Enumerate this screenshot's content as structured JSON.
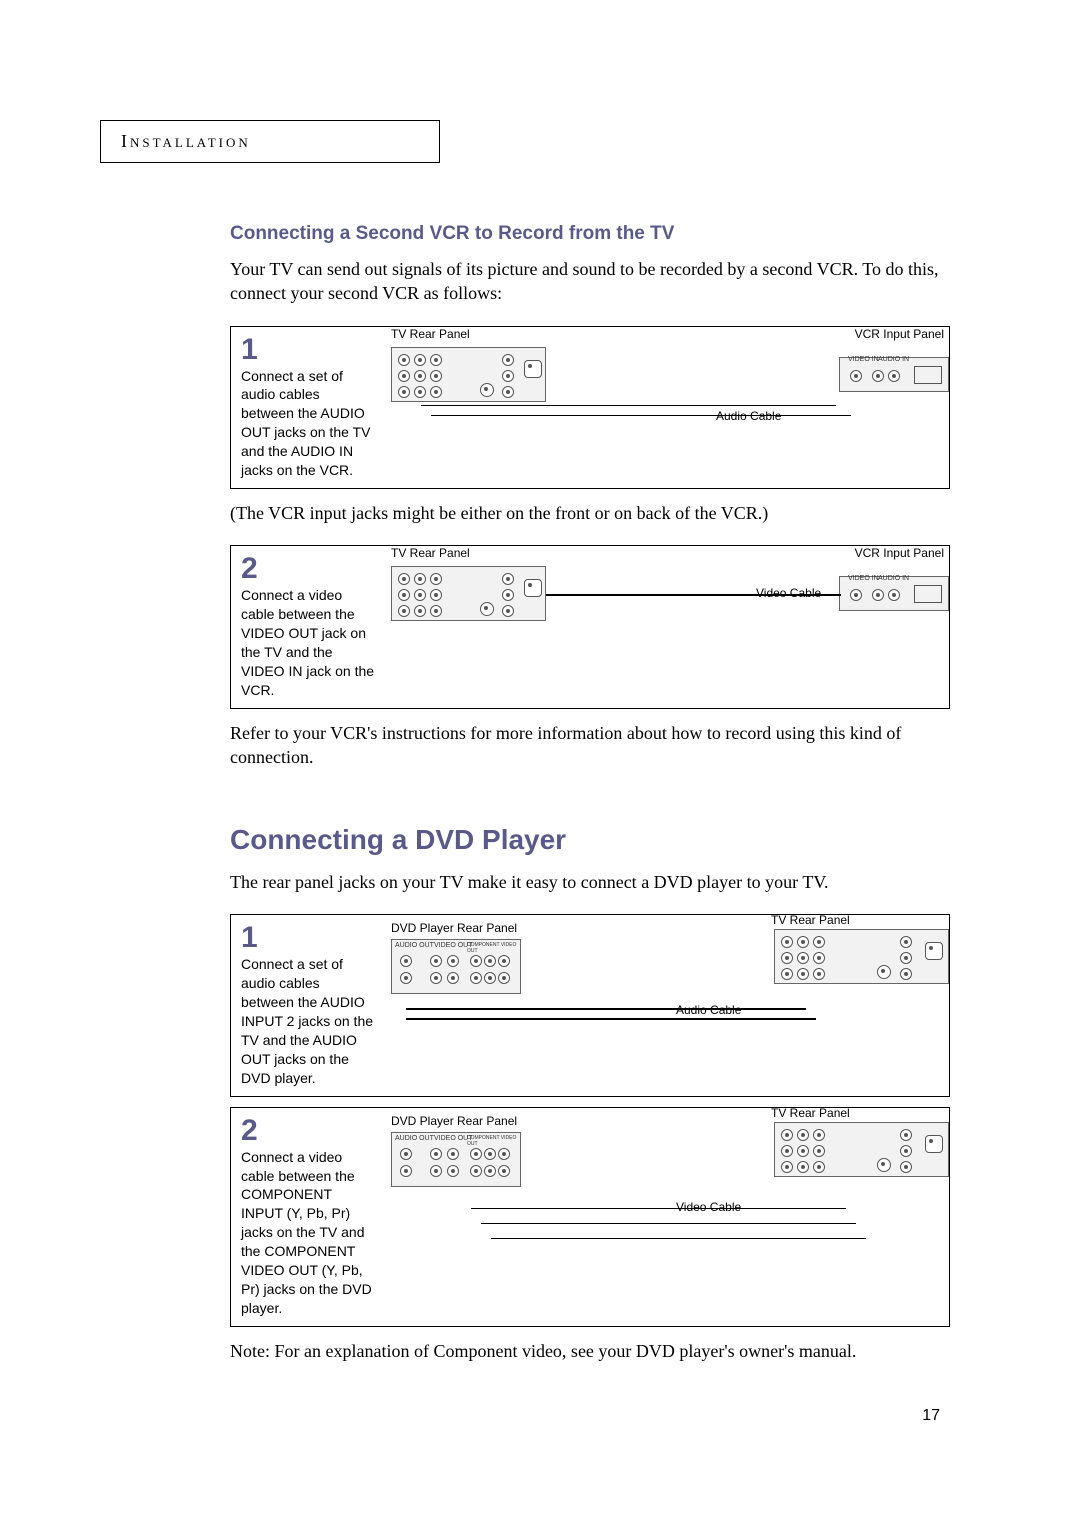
{
  "header": "Installation",
  "subtitle1": "Connecting a Second VCR to Record from the TV",
  "intro1": "Your TV can send out signals of its picture and sound to be recorded by a second VCR. To do this, connect your second VCR as follows:",
  "vcr": {
    "step1": {
      "num": "1",
      "text": "Connect a set of audio cables between the AUDIO OUT jacks on the TV and the AUDIO IN jacks on the VCR.",
      "tv_label": "TV Rear Panel",
      "vcr_label": "VCR Input Panel",
      "cable": "Audio Cable",
      "vcr_jack_video": "VIDEO IN",
      "vcr_jack_audio": "AUDIO IN"
    },
    "note_between": "(The VCR input jacks might be either on the front or on back of the VCR.)",
    "step2": {
      "num": "2",
      "text": "Connect a video cable between the VIDEO OUT jack on the TV and the VIDEO IN jack on the VCR.",
      "tv_label": "TV Rear Panel",
      "vcr_label": "VCR Input Panel",
      "cable": "Video Cable",
      "vcr_jack_video": "VIDEO IN",
      "vcr_jack_audio": "AUDIO IN"
    },
    "after": "Refer to your VCR's instructions for more information about how to record using this kind of connection."
  },
  "section2": "Connecting a DVD Player",
  "intro2": "The rear panel jacks on your TV make it easy to connect a DVD player to your TV.",
  "dvd": {
    "step1": {
      "num": "1",
      "text": "Connect a set of audio cables between the AUDIO INPUT 2 jacks on the TV and the AUDIO OUT jacks on the DVD player.",
      "dvd_label": "DVD Player Rear Panel",
      "tv_label": "TV Rear Panel",
      "cable": "Audio Cable",
      "dvd_jacks": {
        "a": "AUDIO OUT",
        "b": "VIDEO OUT",
        "c": "COMPONENT VIDEO OUT"
      }
    },
    "step2": {
      "num": "2",
      "text": "Connect a video cable between the COMPO­NENT INPUT (Y, Pb, Pr) jacks on the TV and the COMPONENT VIDEO OUT (Y, Pb, Pr) jacks on the DVD player.",
      "dvd_label": "DVD Player Rear Panel",
      "tv_label": "TV Rear Panel",
      "cable": "Video Cable",
      "dvd_jacks": {
        "a": "AUDIO OUT",
        "b": "VIDEO OUT",
        "c": "COMPONENT VIDEO OUT"
      }
    }
  },
  "footnote": "Note: For an explanation of Component video, see your DVD player's owner's manual.",
  "page": "17"
}
